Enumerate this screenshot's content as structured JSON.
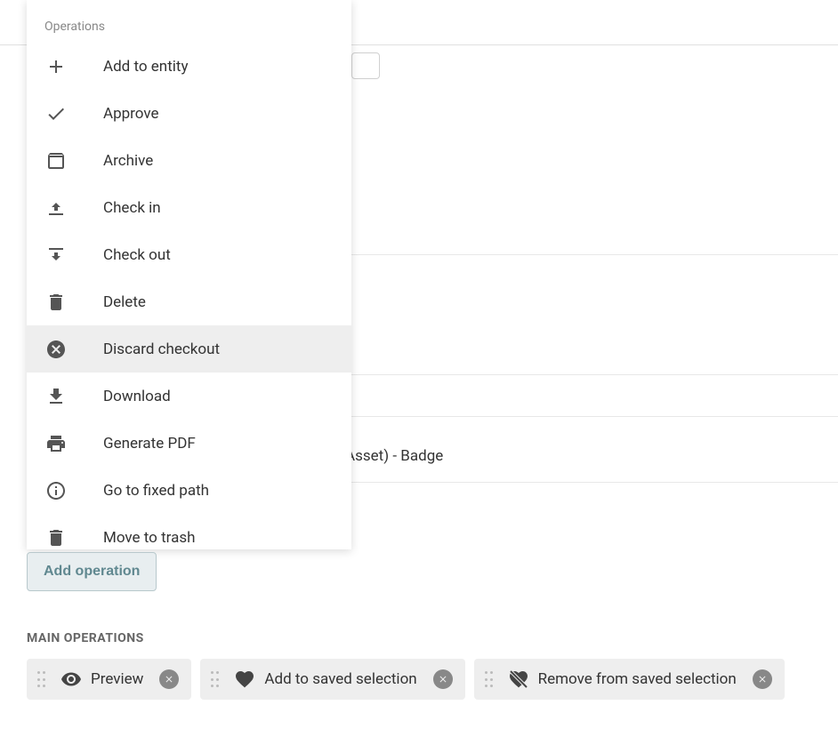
{
  "dropdown": {
    "header": "Operations",
    "items": [
      {
        "icon": "plus",
        "label": "Add to entity",
        "highlighted": false
      },
      {
        "icon": "check",
        "label": "Approve",
        "highlighted": false
      },
      {
        "icon": "archive",
        "label": "Archive",
        "highlighted": false
      },
      {
        "icon": "checkin",
        "label": "Check in",
        "highlighted": false
      },
      {
        "icon": "checkout",
        "label": "Check out",
        "highlighted": false
      },
      {
        "icon": "delete",
        "label": "Delete",
        "highlighted": false
      },
      {
        "icon": "discard",
        "label": "Discard checkout",
        "highlighted": true
      },
      {
        "icon": "download",
        "label": "Download",
        "highlighted": false
      },
      {
        "icon": "pdf",
        "label": "Generate PDF",
        "highlighted": false
      },
      {
        "icon": "info",
        "label": "Go to fixed path",
        "highlighted": false
      },
      {
        "icon": "trash",
        "label": "Move to trash",
        "highlighted": false
      }
    ]
  },
  "background": {
    "partial_text": "eToAsset)  - Badge"
  },
  "add_operation": {
    "label": "Add operation"
  },
  "main_operations": {
    "heading": "MAIN OPERATIONS",
    "items": [
      {
        "icon": "eye",
        "label": "Preview"
      },
      {
        "icon": "heart",
        "label": "Add to saved selection"
      },
      {
        "icon": "heart-off",
        "label": "Remove from saved selection"
      }
    ]
  }
}
